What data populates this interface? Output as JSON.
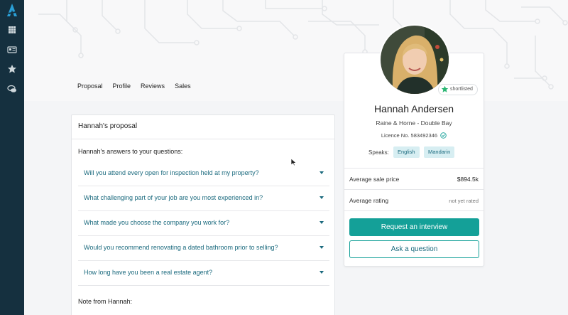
{
  "tabs": [
    "Proposal",
    "Profile",
    "Reviews",
    "Sales"
  ],
  "proposal": {
    "title": "Hannah's proposal",
    "answers_label": "Hannah's answers to your questions:",
    "questions": [
      "Will you attend every open for inspection held at my property?",
      "What challenging part of your job are you most experienced in?",
      "What made you choose the company you work for?",
      "Would you recommend renovating a dated bathroom prior to selling?",
      "How long have you been a real estate agent?"
    ],
    "note_label": "Note from Hannah:"
  },
  "agent": {
    "name": "Hannah Andersen",
    "agency": "Raine & Horne - Double Bay",
    "licence": "Licence No. 583492346",
    "status_badge": "shortlisted",
    "speaks_label": "Speaks:",
    "languages": [
      "English",
      "Mandarin"
    ],
    "stats": [
      {
        "label": "Average sale price",
        "value": "$894.5k"
      },
      {
        "label": "Average rating",
        "value": "not yet rated"
      }
    ]
  },
  "actions": {
    "request_interview": "Request an interview",
    "ask_question": "Ask a question"
  },
  "colors": {
    "sidebar": "#15303f",
    "accent": "#14a098",
    "link": "#1b6a7e",
    "badge_star": "#2bb673"
  },
  "icons": {
    "logo": "logo-icon",
    "sidebar": [
      "grid-icon",
      "id-card-icon",
      "star-icon",
      "chat-icon"
    ]
  }
}
